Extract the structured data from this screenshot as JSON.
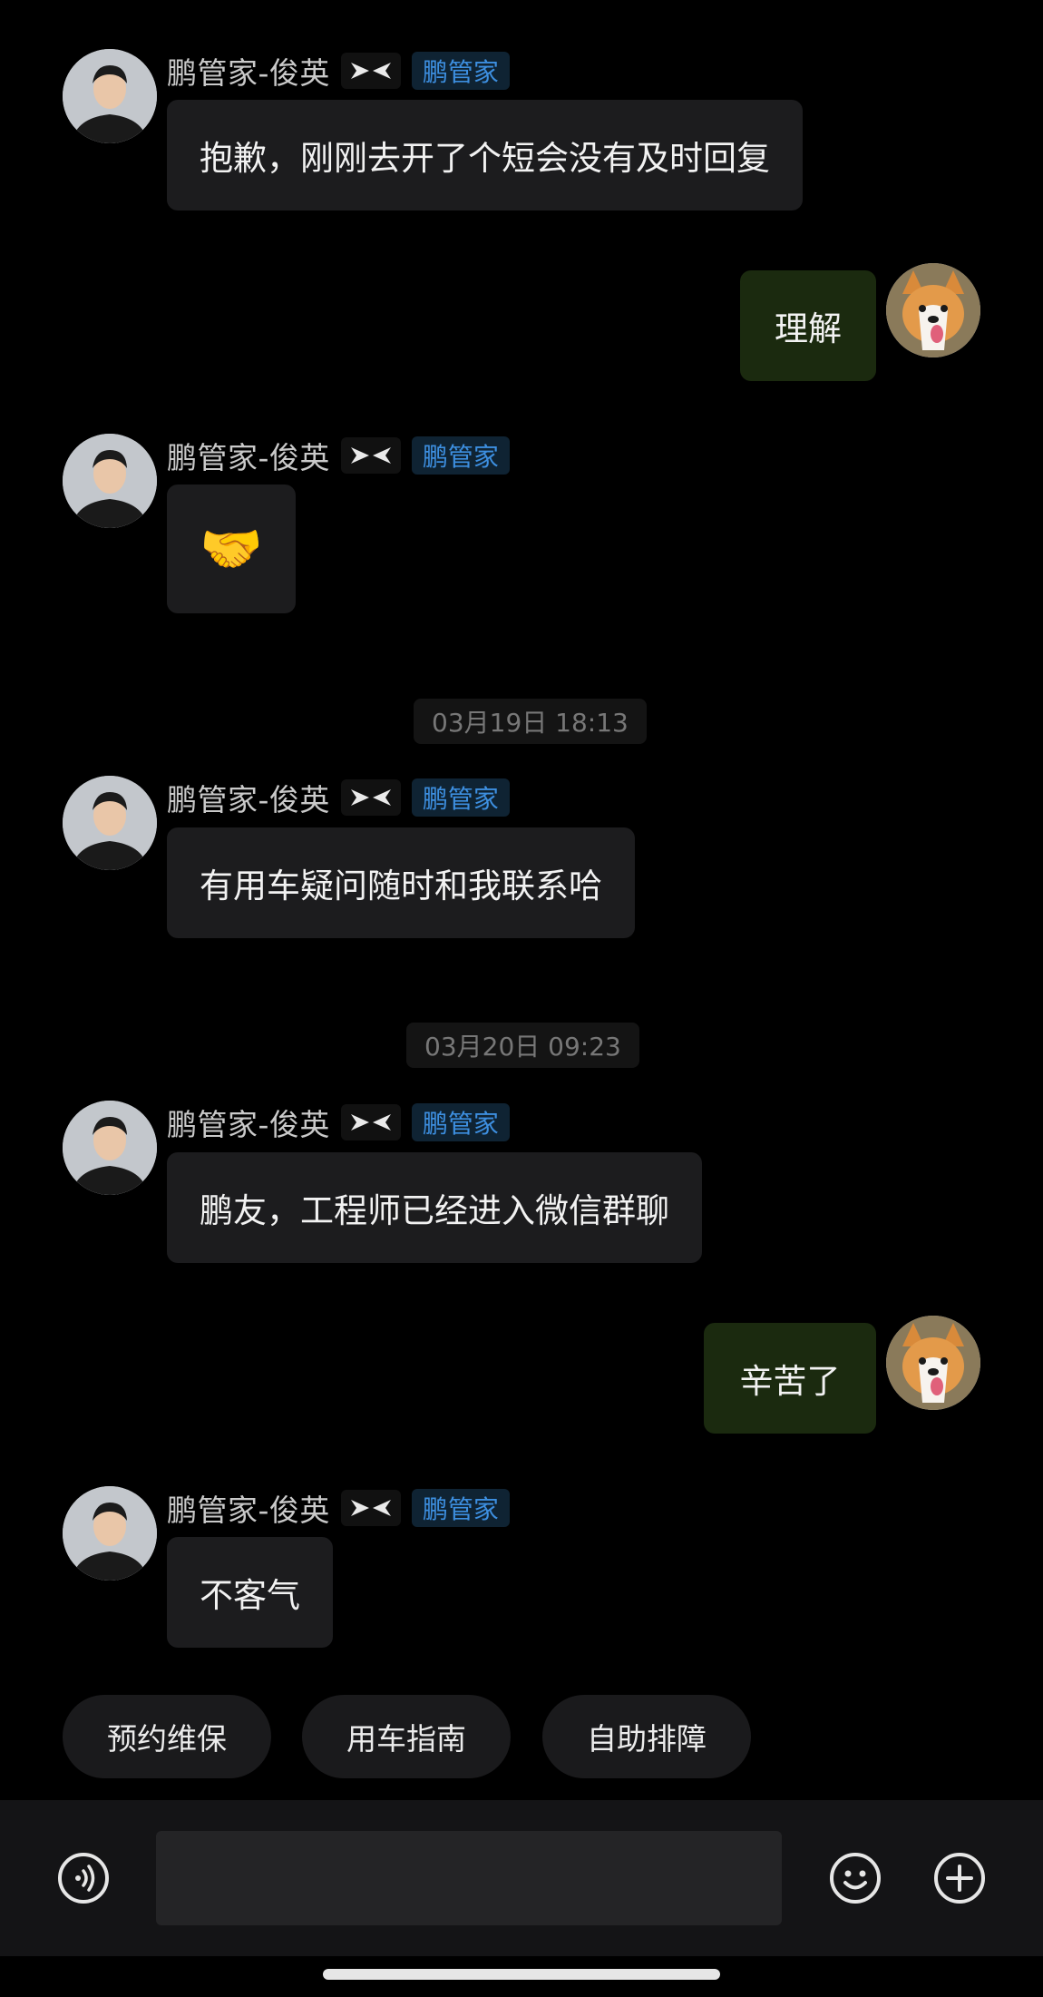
{
  "messages": [
    {
      "sender": "鹏管家-俊英",
      "badge": "鹏管家",
      "text": "抱歉，刚刚去开了个短会没有及时回复"
    },
    {
      "self_text": "理解"
    },
    {
      "sender": "鹏管家-俊英",
      "badge": "鹏管家",
      "emoji": "🤝"
    },
    {
      "timestamp": "03月19日 18:13"
    },
    {
      "sender": "鹏管家-俊英",
      "badge": "鹏管家",
      "text": "有用车疑问随时和我联系哈"
    },
    {
      "timestamp": "03月20日 09:23"
    },
    {
      "sender": "鹏管家-俊英",
      "badge": "鹏管家",
      "text": "鹏友，工程师已经进入微信群聊"
    },
    {
      "self_text": "辛苦了"
    },
    {
      "sender": "鹏管家-俊英",
      "badge": "鹏管家",
      "text": "不客气"
    }
  ],
  "quick_actions": [
    "预约维保",
    "用车指南",
    "自助排障"
  ],
  "input": {
    "placeholder": ""
  },
  "icons": {
    "voice": "voice-icon",
    "emoji": "emoji-smile-icon",
    "plus": "plus-circle-icon",
    "brand": "xpeng-logo-icon"
  },
  "colors": {
    "background": "#000000",
    "agent_bubble": "#1c1c1e",
    "self_bubble": "#1b2a0f",
    "badge_text": "#3d8fe0"
  }
}
